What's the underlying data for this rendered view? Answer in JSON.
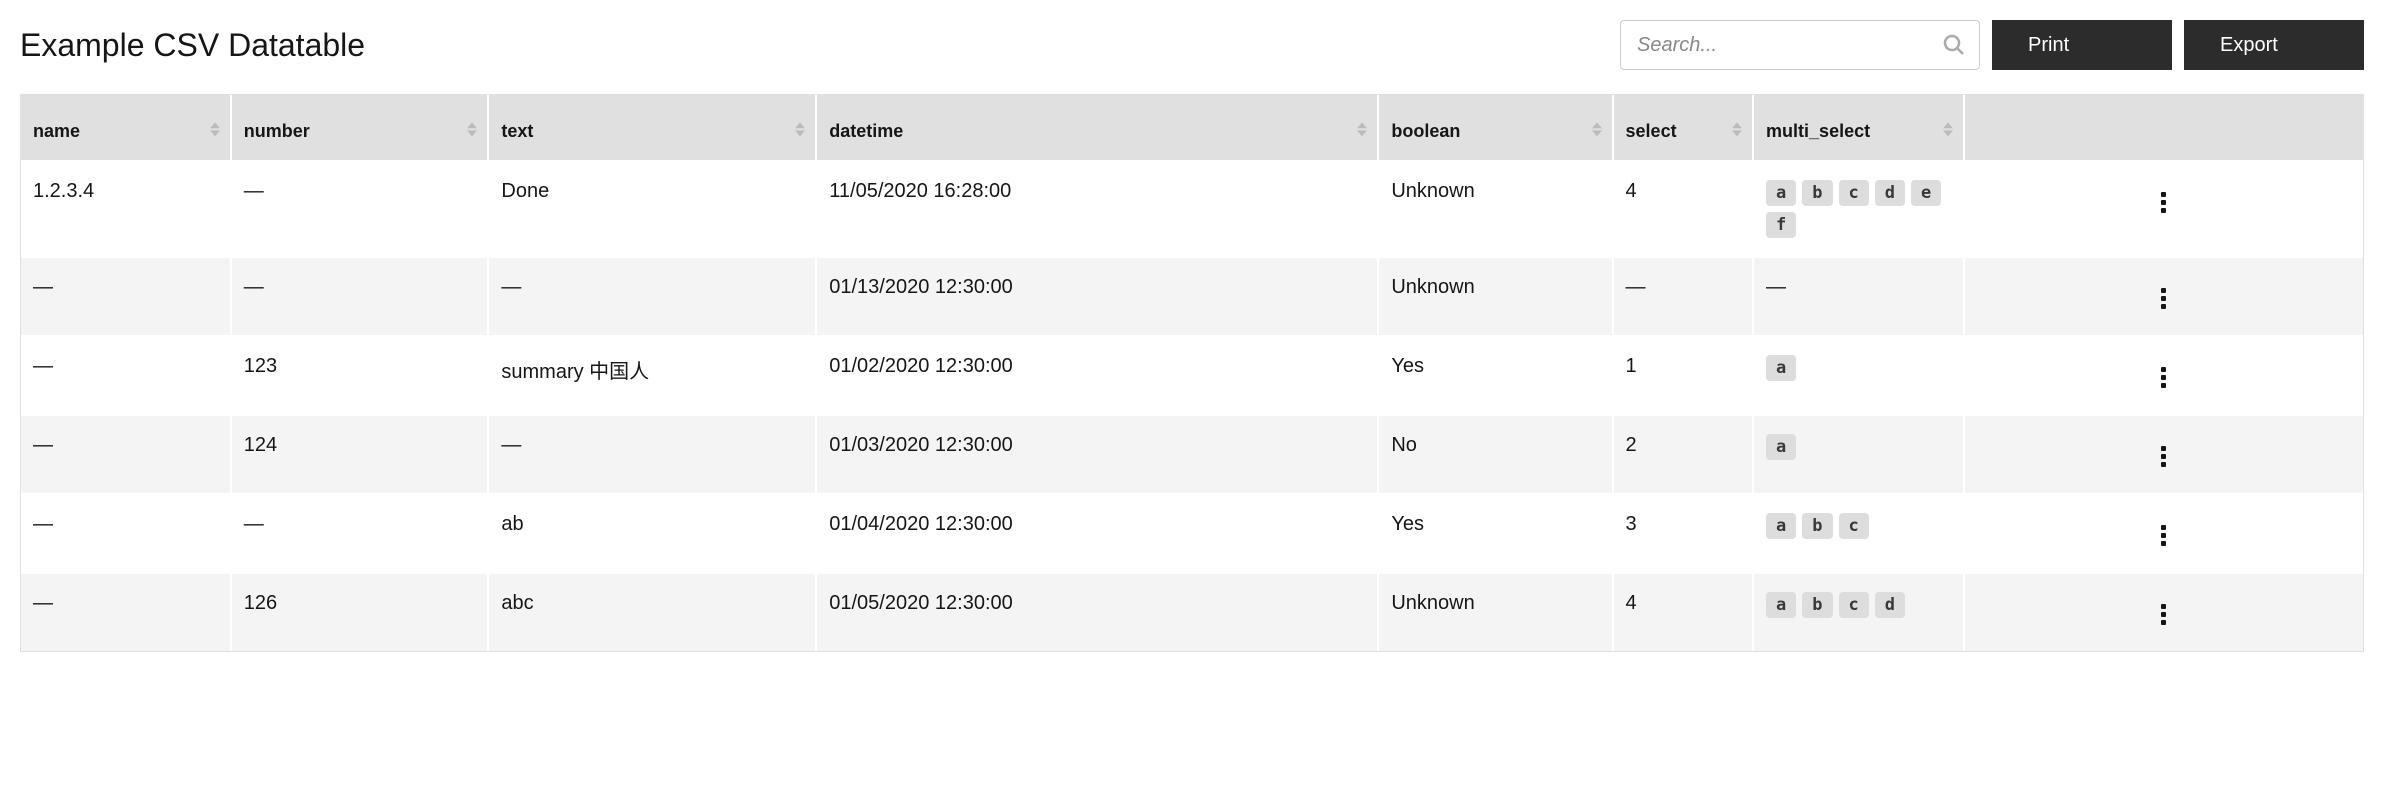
{
  "title": "Example CSV Datatable",
  "search": {
    "placeholder": "Search..."
  },
  "buttons": {
    "print": "Print",
    "export": "Export"
  },
  "columns": [
    {
      "key": "name",
      "label": "name",
      "sortable": true
    },
    {
      "key": "number",
      "label": "number",
      "sortable": true
    },
    {
      "key": "text",
      "label": "text",
      "sortable": true
    },
    {
      "key": "datetime",
      "label": "datetime",
      "sortable": true
    },
    {
      "key": "boolean",
      "label": "boolean",
      "sortable": true
    },
    {
      "key": "select",
      "label": "select",
      "sortable": true
    },
    {
      "key": "multi_select",
      "label": "multi_select",
      "sortable": true
    },
    {
      "key": "actions",
      "label": "",
      "sortable": false
    }
  ],
  "rows": [
    {
      "name": "1.2.3.4",
      "number": null,
      "text": "Done",
      "datetime": "11/05/2020 16:28:00",
      "boolean": "Unknown",
      "select": "4",
      "multi_select": [
        "a",
        "b",
        "c",
        "d",
        "e",
        "f"
      ]
    },
    {
      "name": null,
      "number": null,
      "text": null,
      "datetime": "01/13/2020 12:30:00",
      "boolean": "Unknown",
      "select": null,
      "multi_select": null
    },
    {
      "name": null,
      "number": "123",
      "text": "summary 中国人",
      "datetime": "01/02/2020 12:30:00",
      "boolean": "Yes",
      "select": "1",
      "multi_select": [
        "a"
      ]
    },
    {
      "name": null,
      "number": "124",
      "text": null,
      "datetime": "01/03/2020 12:30:00",
      "boolean": "No",
      "select": "2",
      "multi_select": [
        "a"
      ]
    },
    {
      "name": null,
      "number": null,
      "text": "ab",
      "datetime": "01/04/2020 12:30:00",
      "boolean": "Yes",
      "select": "3",
      "multi_select": [
        "a",
        "b",
        "c"
      ]
    },
    {
      "name": null,
      "number": "126",
      "text": "abc",
      "datetime": "01/05/2020 12:30:00",
      "boolean": "Unknown",
      "select": "4",
      "multi_select": [
        "a",
        "b",
        "c",
        "d"
      ]
    }
  ],
  "empty": "—"
}
